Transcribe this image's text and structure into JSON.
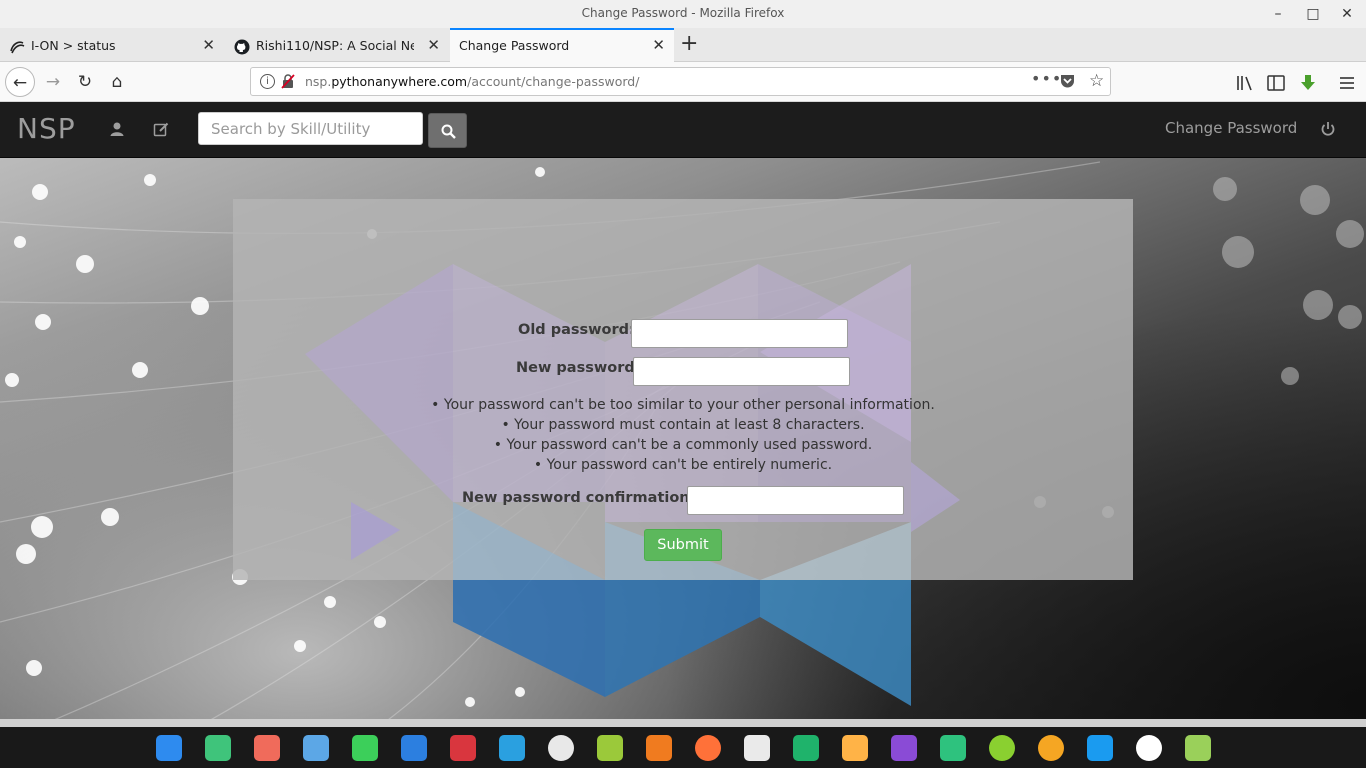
{
  "window": {
    "title": "Change Password - Mozilla Firefox"
  },
  "tabs": [
    {
      "label": "I-ON > status",
      "icon": "ion-favicon-icon"
    },
    {
      "label": "Rishi110/NSP: A Social Network",
      "icon": "github-favicon-icon"
    },
    {
      "label": "Change Password",
      "icon": "page-icon"
    }
  ],
  "url": {
    "domain": "nsp.",
    "host_strong": "pythonanywhere.com",
    "path": "/account/change-password/"
  },
  "site": {
    "brand": "NSP",
    "search_placeholder": "Search by Skill/Utility",
    "nav_link": "Change Password"
  },
  "form": {
    "old_label": "Old password:",
    "new_label": "New password:",
    "help": [
      "Your password can't be too similar to your other personal information.",
      "Your password must contain at least 8 characters.",
      "Your password can't be a commonly used password.",
      "Your password can't be entirely numeric."
    ],
    "confirm_label": "New password confirmation:",
    "submit_label": "Submit"
  },
  "colors": {
    "accent_tab": "#0a84ff",
    "submit": "#5cb85c",
    "navbar": "#1c1c1c"
  },
  "dock_icons": [
    "app-grid-icon",
    "file-manager-icon",
    "screen-recorder-icon",
    "archive-icon",
    "music-icon",
    "video-icon",
    "terminal-icon",
    "telegram-icon",
    "settings-icon",
    "android-icon",
    "sync-icon",
    "firefox-icon",
    "spider-icon",
    "pycharm-icon",
    "moon-icon",
    "media-player-icon",
    "android-studio-icon",
    "power-icon",
    "clock-icon",
    "wifi-icon",
    "time-widget-icon",
    "trash-icon"
  ]
}
